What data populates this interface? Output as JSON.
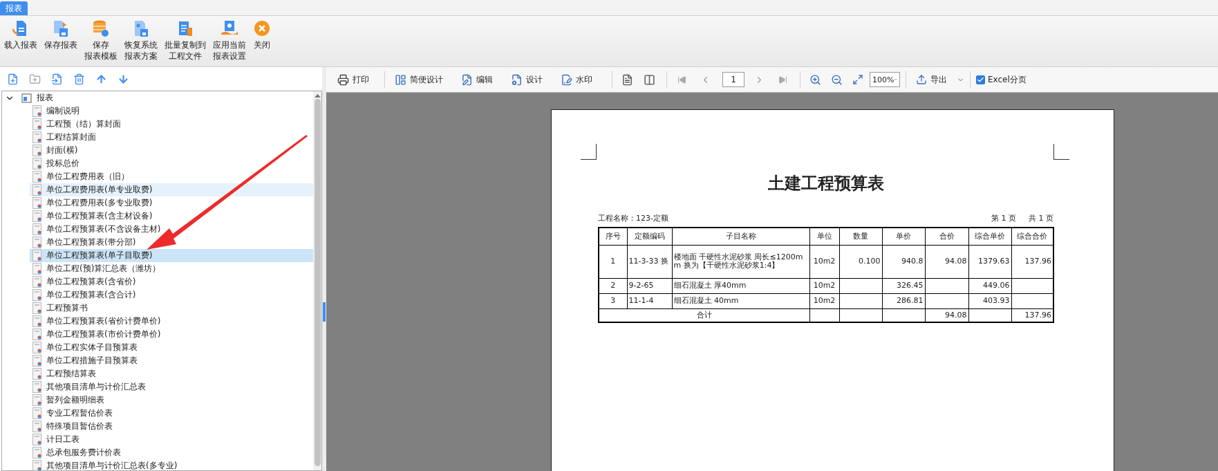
{
  "tab": {
    "label": "报表",
    "selected": true
  },
  "ribbon": [
    {
      "kind": "load",
      "lines": [
        "载入报表"
      ]
    },
    {
      "kind": "save",
      "lines": [
        "保存报表"
      ]
    },
    {
      "kind": "template",
      "lines": [
        "保存",
        "报表模板"
      ]
    },
    {
      "kind": "restore",
      "lines": [
        "恢复系统",
        "报表方案"
      ]
    },
    {
      "kind": "batch",
      "lines": [
        "批量复制到",
        "工程文件"
      ]
    },
    {
      "kind": "apply",
      "lines": [
        "应用当前",
        "报表设置"
      ]
    },
    {
      "kind": "close",
      "lines": [
        "关闭"
      ]
    }
  ],
  "tree": {
    "label": "报表",
    "expanded": true,
    "children": [
      {
        "label": "编制说明",
        "selected": false,
        "hovered": false
      },
      {
        "label": "工程预（结）算封面",
        "selected": false,
        "hovered": false
      },
      {
        "label": "工程结算封面",
        "selected": false,
        "hovered": false
      },
      {
        "label": "封面(横)",
        "selected": false,
        "hovered": false
      },
      {
        "label": "投标总价",
        "selected": false,
        "hovered": false
      },
      {
        "label": "单位工程费用表（旧）",
        "selected": false,
        "hovered": false
      },
      {
        "label": "单位工程费用表(单专业取费)",
        "selected": false,
        "hovered": true
      },
      {
        "label": "单位工程费用表(多专业取费)",
        "selected": false,
        "hovered": false
      },
      {
        "label": "单位工程预算表(含主材设备)",
        "selected": false,
        "hovered": false
      },
      {
        "label": "单位工程预算表(不含设备主材)",
        "selected": false,
        "hovered": false
      },
      {
        "label": "单位工程预算表(带分部)",
        "selected": false,
        "hovered": false
      },
      {
        "label": "单位工程预算表(单子目取费)",
        "selected": true,
        "hovered": false
      },
      {
        "label": "单位工程(预)算汇总表（潍坊）",
        "selected": false,
        "hovered": false
      },
      {
        "label": "单位工程预算表(含省价)",
        "selected": false,
        "hovered": false
      },
      {
        "label": "单位工程预算表(含合计)",
        "selected": false,
        "hovered": false
      },
      {
        "label": "工程预算书",
        "selected": false,
        "hovered": false
      },
      {
        "label": "单位工程预算表(省价计费单价)",
        "selected": false,
        "hovered": false
      },
      {
        "label": "单位工程预算表(市价计费单价)",
        "selected": false,
        "hovered": false
      },
      {
        "label": "单位工程实体子目预算表",
        "selected": false,
        "hovered": false
      },
      {
        "label": "单位工程措施子目预算表",
        "selected": false,
        "hovered": false
      },
      {
        "label": "工程预结算表",
        "selected": false,
        "hovered": false
      },
      {
        "label": "其他项目清单与计价汇总表",
        "selected": false,
        "hovered": false
      },
      {
        "label": "暂列金额明细表",
        "selected": false,
        "hovered": false
      },
      {
        "label": "专业工程暂估价表",
        "selected": false,
        "hovered": false
      },
      {
        "label": "特殊项目暂估价表",
        "selected": false,
        "hovered": false
      },
      {
        "label": "计日工表",
        "selected": false,
        "hovered": false
      },
      {
        "label": "总承包服务费计价表",
        "selected": false,
        "hovered": false
      },
      {
        "label": "其他项目清单与计价汇总表(多专业)",
        "selected": false,
        "hovered": false
      }
    ]
  },
  "report_toolbar": {
    "buttons": [
      {
        "kind": "print",
        "label": "打印"
      },
      {
        "kind": "layout",
        "label": "简便设计"
      },
      {
        "kind": "edit",
        "label": "编辑"
      },
      {
        "kind": "design",
        "label": "设计"
      },
      {
        "kind": "watermark",
        "label": "水印"
      }
    ],
    "page_input": "1",
    "zoom": "100%",
    "export": "导出",
    "excel": {
      "label": "Excel分页",
      "checked": true
    }
  },
  "report": {
    "title": "土建工程预算表",
    "project": "工程名称：123-定额",
    "page_no": "第 1 页",
    "page_total": "共 1 页",
    "columns": [
      "序号",
      "定额编码",
      "子目名称",
      "单位",
      "数量",
      "单价",
      "合价",
      "综合单价",
      "综合合价"
    ],
    "rows": [
      [
        "1",
        "11-3-33 换",
        "楼地面 干硬性水泥砂浆 周长≤1200mm  换为【干硬性水泥砂浆1:4】",
        "10m2",
        "0.100",
        "940.8",
        "94.08",
        "1379.63",
        "137.96"
      ],
      [
        "2",
        "9-2-65",
        "细石混凝土 厚40mm",
        "10m2",
        null,
        "326.45",
        null,
        "449.06",
        null
      ],
      [
        "3",
        "11-1-4",
        "细石混凝土 40mm",
        "10m2",
        null,
        "286.81",
        null,
        "403.93",
        null
      ]
    ],
    "total": {
      "label": "合计",
      "cells": [
        null,
        null,
        null,
        "94.08",
        null,
        "137.96"
      ]
    }
  }
}
